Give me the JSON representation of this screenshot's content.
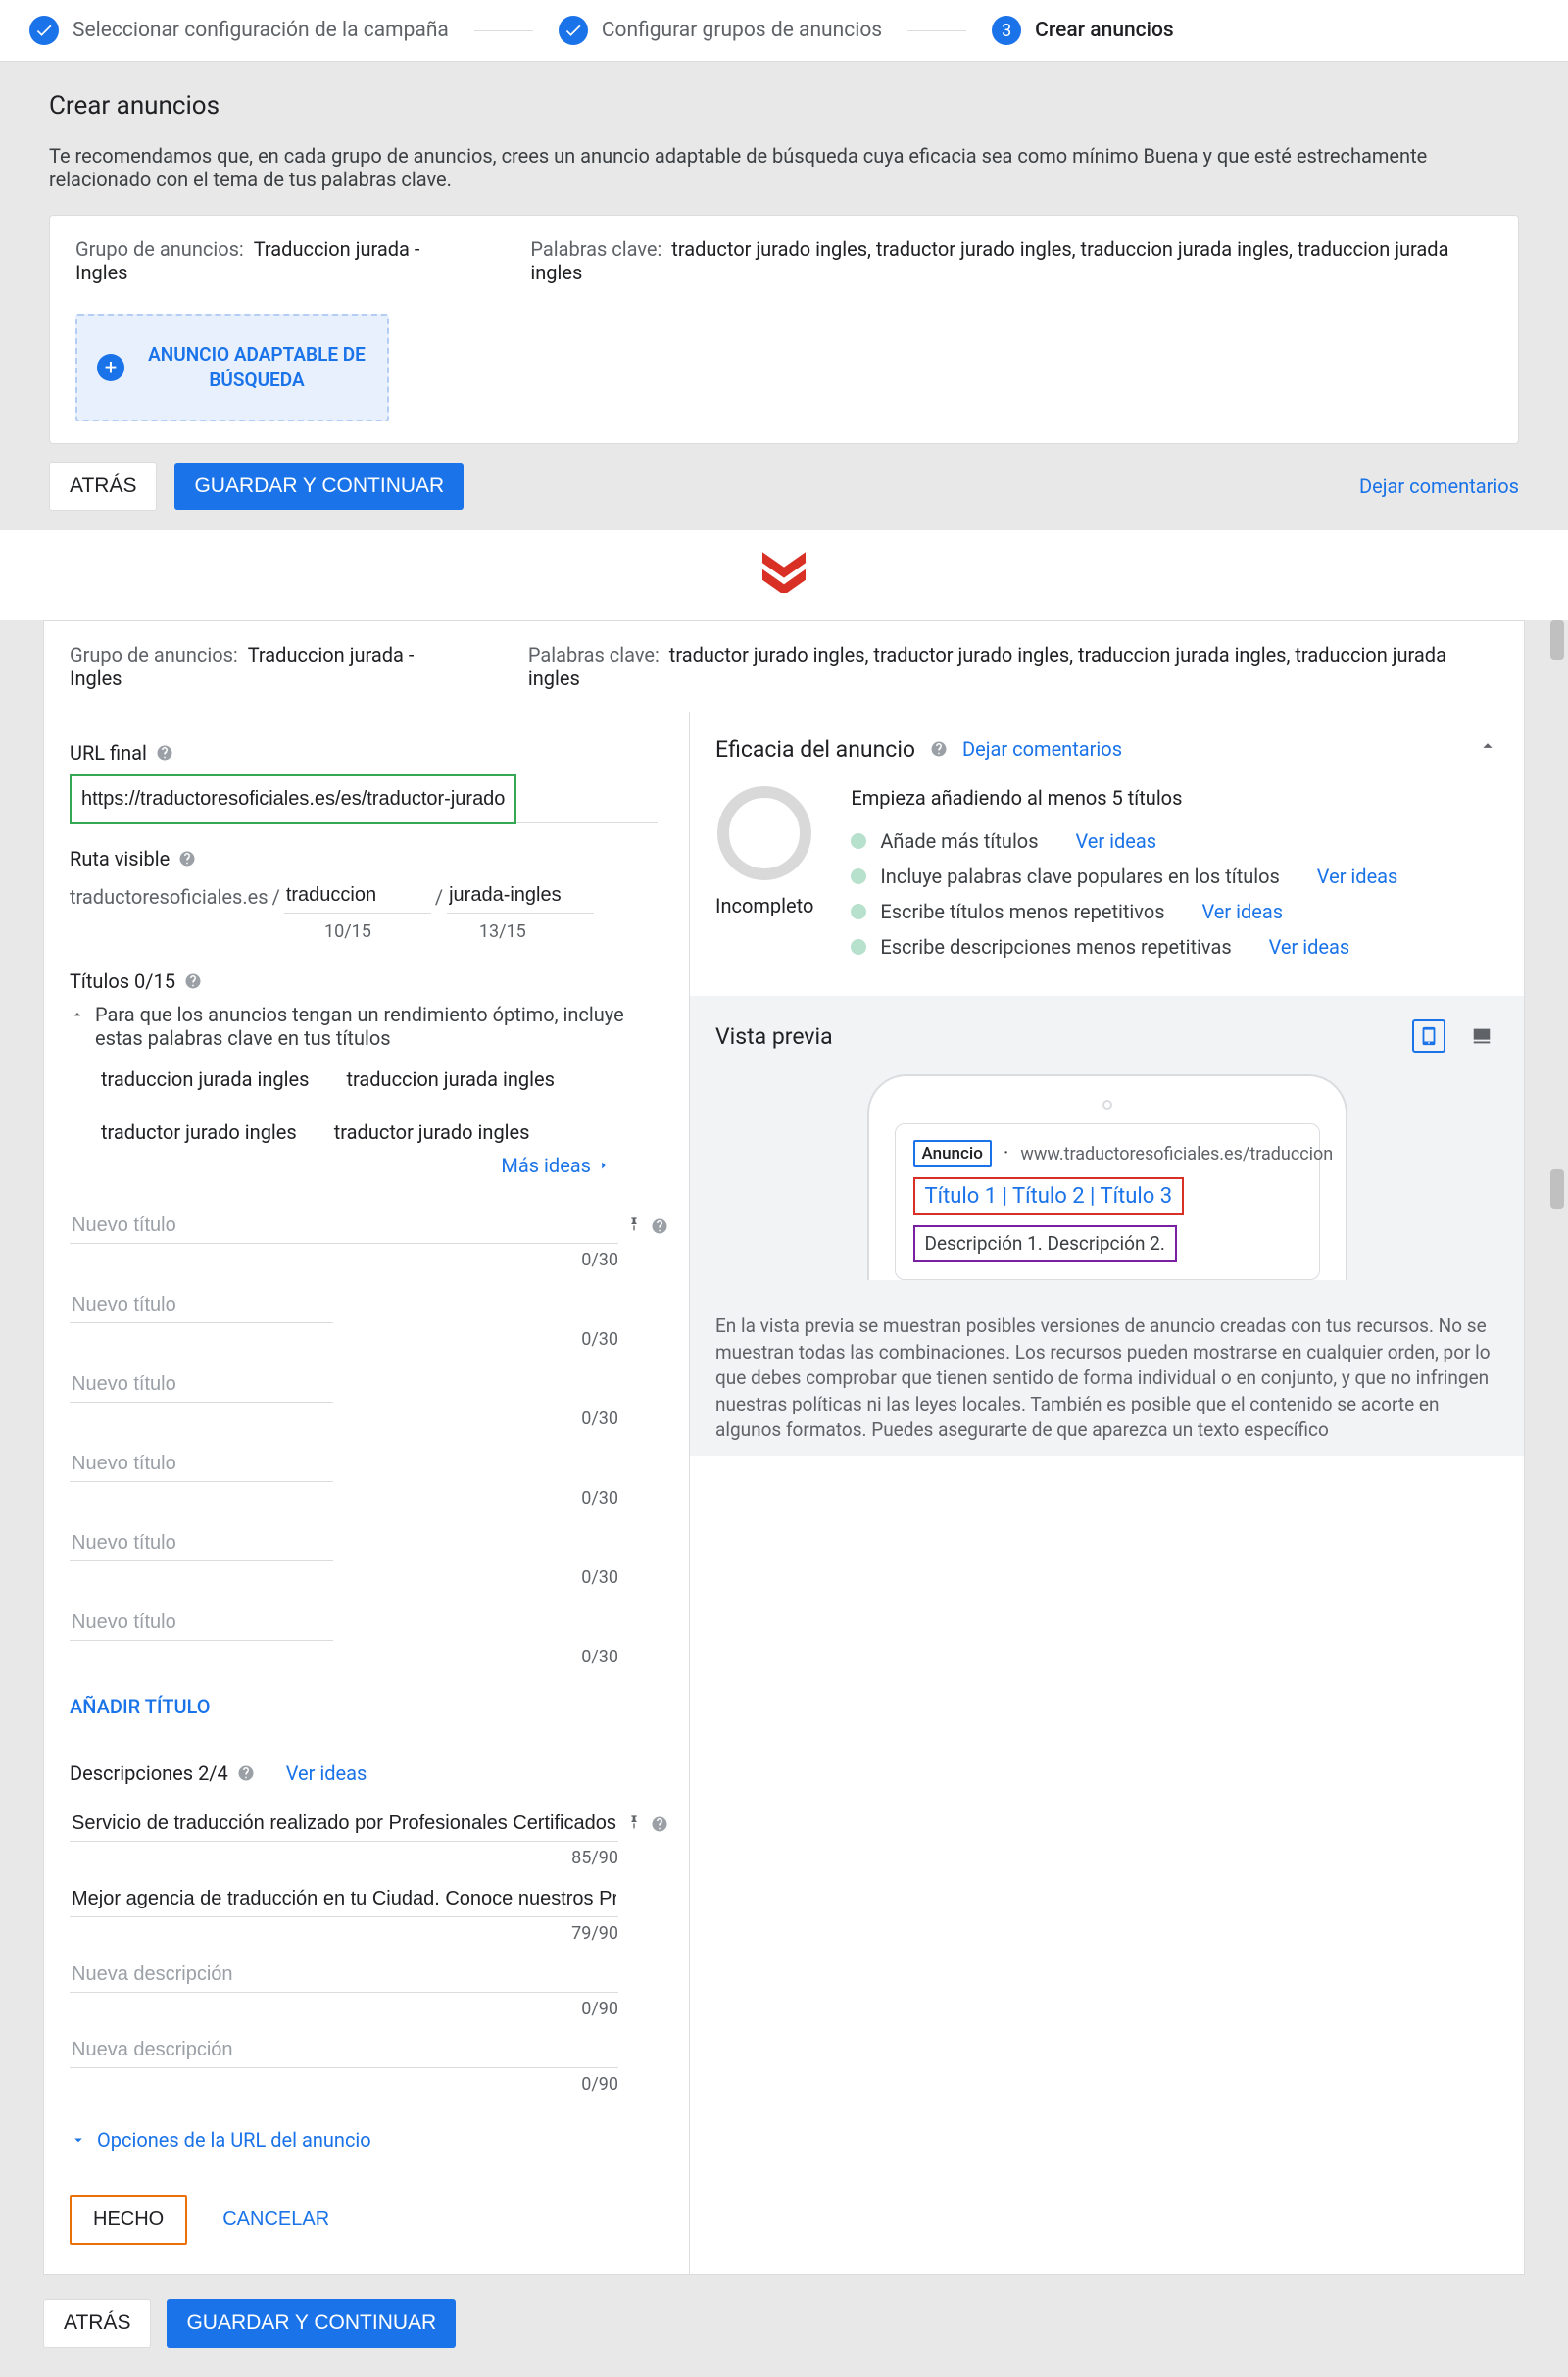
{
  "stepper": {
    "step1": "Seleccionar configuración de la campaña",
    "step2": "Configurar grupos de anuncios",
    "step3_num": "3",
    "step3": "Crear anuncios"
  },
  "panel1": {
    "title": "Crear anuncios",
    "desc": "Te recomendamos que, en cada grupo de anuncios, crees un anuncio adaptable de búsqueda cuya eficacia sea como mínimo Buena y que esté estrechamente relacionado con el tema de tus palabras clave.",
    "group_label": "Grupo de anuncios:",
    "group_value": "Traduccion jurada - Ingles",
    "kw_label": "Palabras clave:",
    "kw_value": "traductor jurado ingles, traductor jurado ingles, traduccion jurada ingles, traduccion jurada ingles",
    "rsa_btn": "ANUNCIO ADAPTABLE DE BÚSQUEDA",
    "back": "ATRÁS",
    "save": "GUARDAR Y CONTINUAR",
    "feedback": "Dejar comentarios"
  },
  "panel2": {
    "group_label": "Grupo de anuncios:",
    "group_value": "Traduccion jurada - Ingles",
    "kw_label": "Palabras clave:",
    "kw_value": "traductor jurado ingles, traductor jurado ingles, traduccion jurada ingles, traduccion jurada ingles",
    "final_url_label": "URL final",
    "final_url_value": "https://traductoresoficiales.es/es/traductor-jurado-de-ingles/",
    "path_label": "Ruta visible",
    "path_domain": "traductoresoficiales.es",
    "path_sep": "/",
    "path1": "traduccion",
    "path2": "jurada-ingles",
    "path1_count": "10/15",
    "path2_count": "13/15",
    "titles_header": "Títulos 0/15",
    "titles_hint": "Para que los anuncios tengan un rendimiento óptimo, incluye estas palabras clave en tus títulos",
    "kw_suggestions": [
      "traduccion jurada ingles",
      "traduccion jurada ingles",
      "traductor jurado ingles",
      "traductor jurado ingles"
    ],
    "more_ideas": "Más ideas",
    "title_placeholder": "Nuevo título",
    "title_count": "0/30",
    "add_title": "AÑADIR TÍTULO",
    "desc_header": "Descripciones 2/4",
    "desc_ideas": "Ver ideas",
    "desc1": "Servicio de traducción realizado por Profesionales Certificados ¡Solicita una P",
    "desc1_count": "85/90",
    "desc2": "Mejor agencia de traducción en tu Ciudad. Conoce nuestros Proyectos Anteric",
    "desc2_count": "79/90",
    "desc_placeholder": "Nueva descripción",
    "desc_empty_count": "0/90",
    "url_options": "Opciones de la URL del anuncio",
    "done": "HECHO",
    "cancel": "CANCELAR",
    "back": "ATRÁS",
    "save": "GUARDAR Y CONTINUAR"
  },
  "strength": {
    "title": "Eficacia del anuncio",
    "feedback": "Dejar comentarios",
    "status": "Incompleto",
    "start": "Empieza añadiendo al menos 5 títulos",
    "items": [
      {
        "text": "Añade más títulos",
        "idea": "Ver ideas"
      },
      {
        "text": "Incluye palabras clave populares en los títulos",
        "idea": "Ver ideas"
      },
      {
        "text": "Escribe títulos menos repetitivos",
        "idea": "Ver ideas"
      },
      {
        "text": "Escribe descripciones menos repetitivas",
        "idea": "Ver ideas"
      }
    ]
  },
  "preview": {
    "title": "Vista previa",
    "ad_badge": "Anuncio",
    "ad_url_sep": "·",
    "ad_url": "www.traductoresoficiales.es/traduccion",
    "ad_titles": "Título 1 | Título 2 | Título 3",
    "ad_desc": "Descripción 1. Descripción 2.",
    "note": "En la vista previa se muestran posibles versiones de anuncio creadas con tus recursos. No se muestran todas las combinaciones. Los recursos pueden mostrarse en cualquier orden, por lo que debes comprobar que tienen sentido de forma individual o en conjunto, y que no infringen nuestras políticas ni las leyes locales. También es posible que el contenido se acorte en algunos formatos. Puedes asegurarte de que aparezca un texto específico"
  }
}
